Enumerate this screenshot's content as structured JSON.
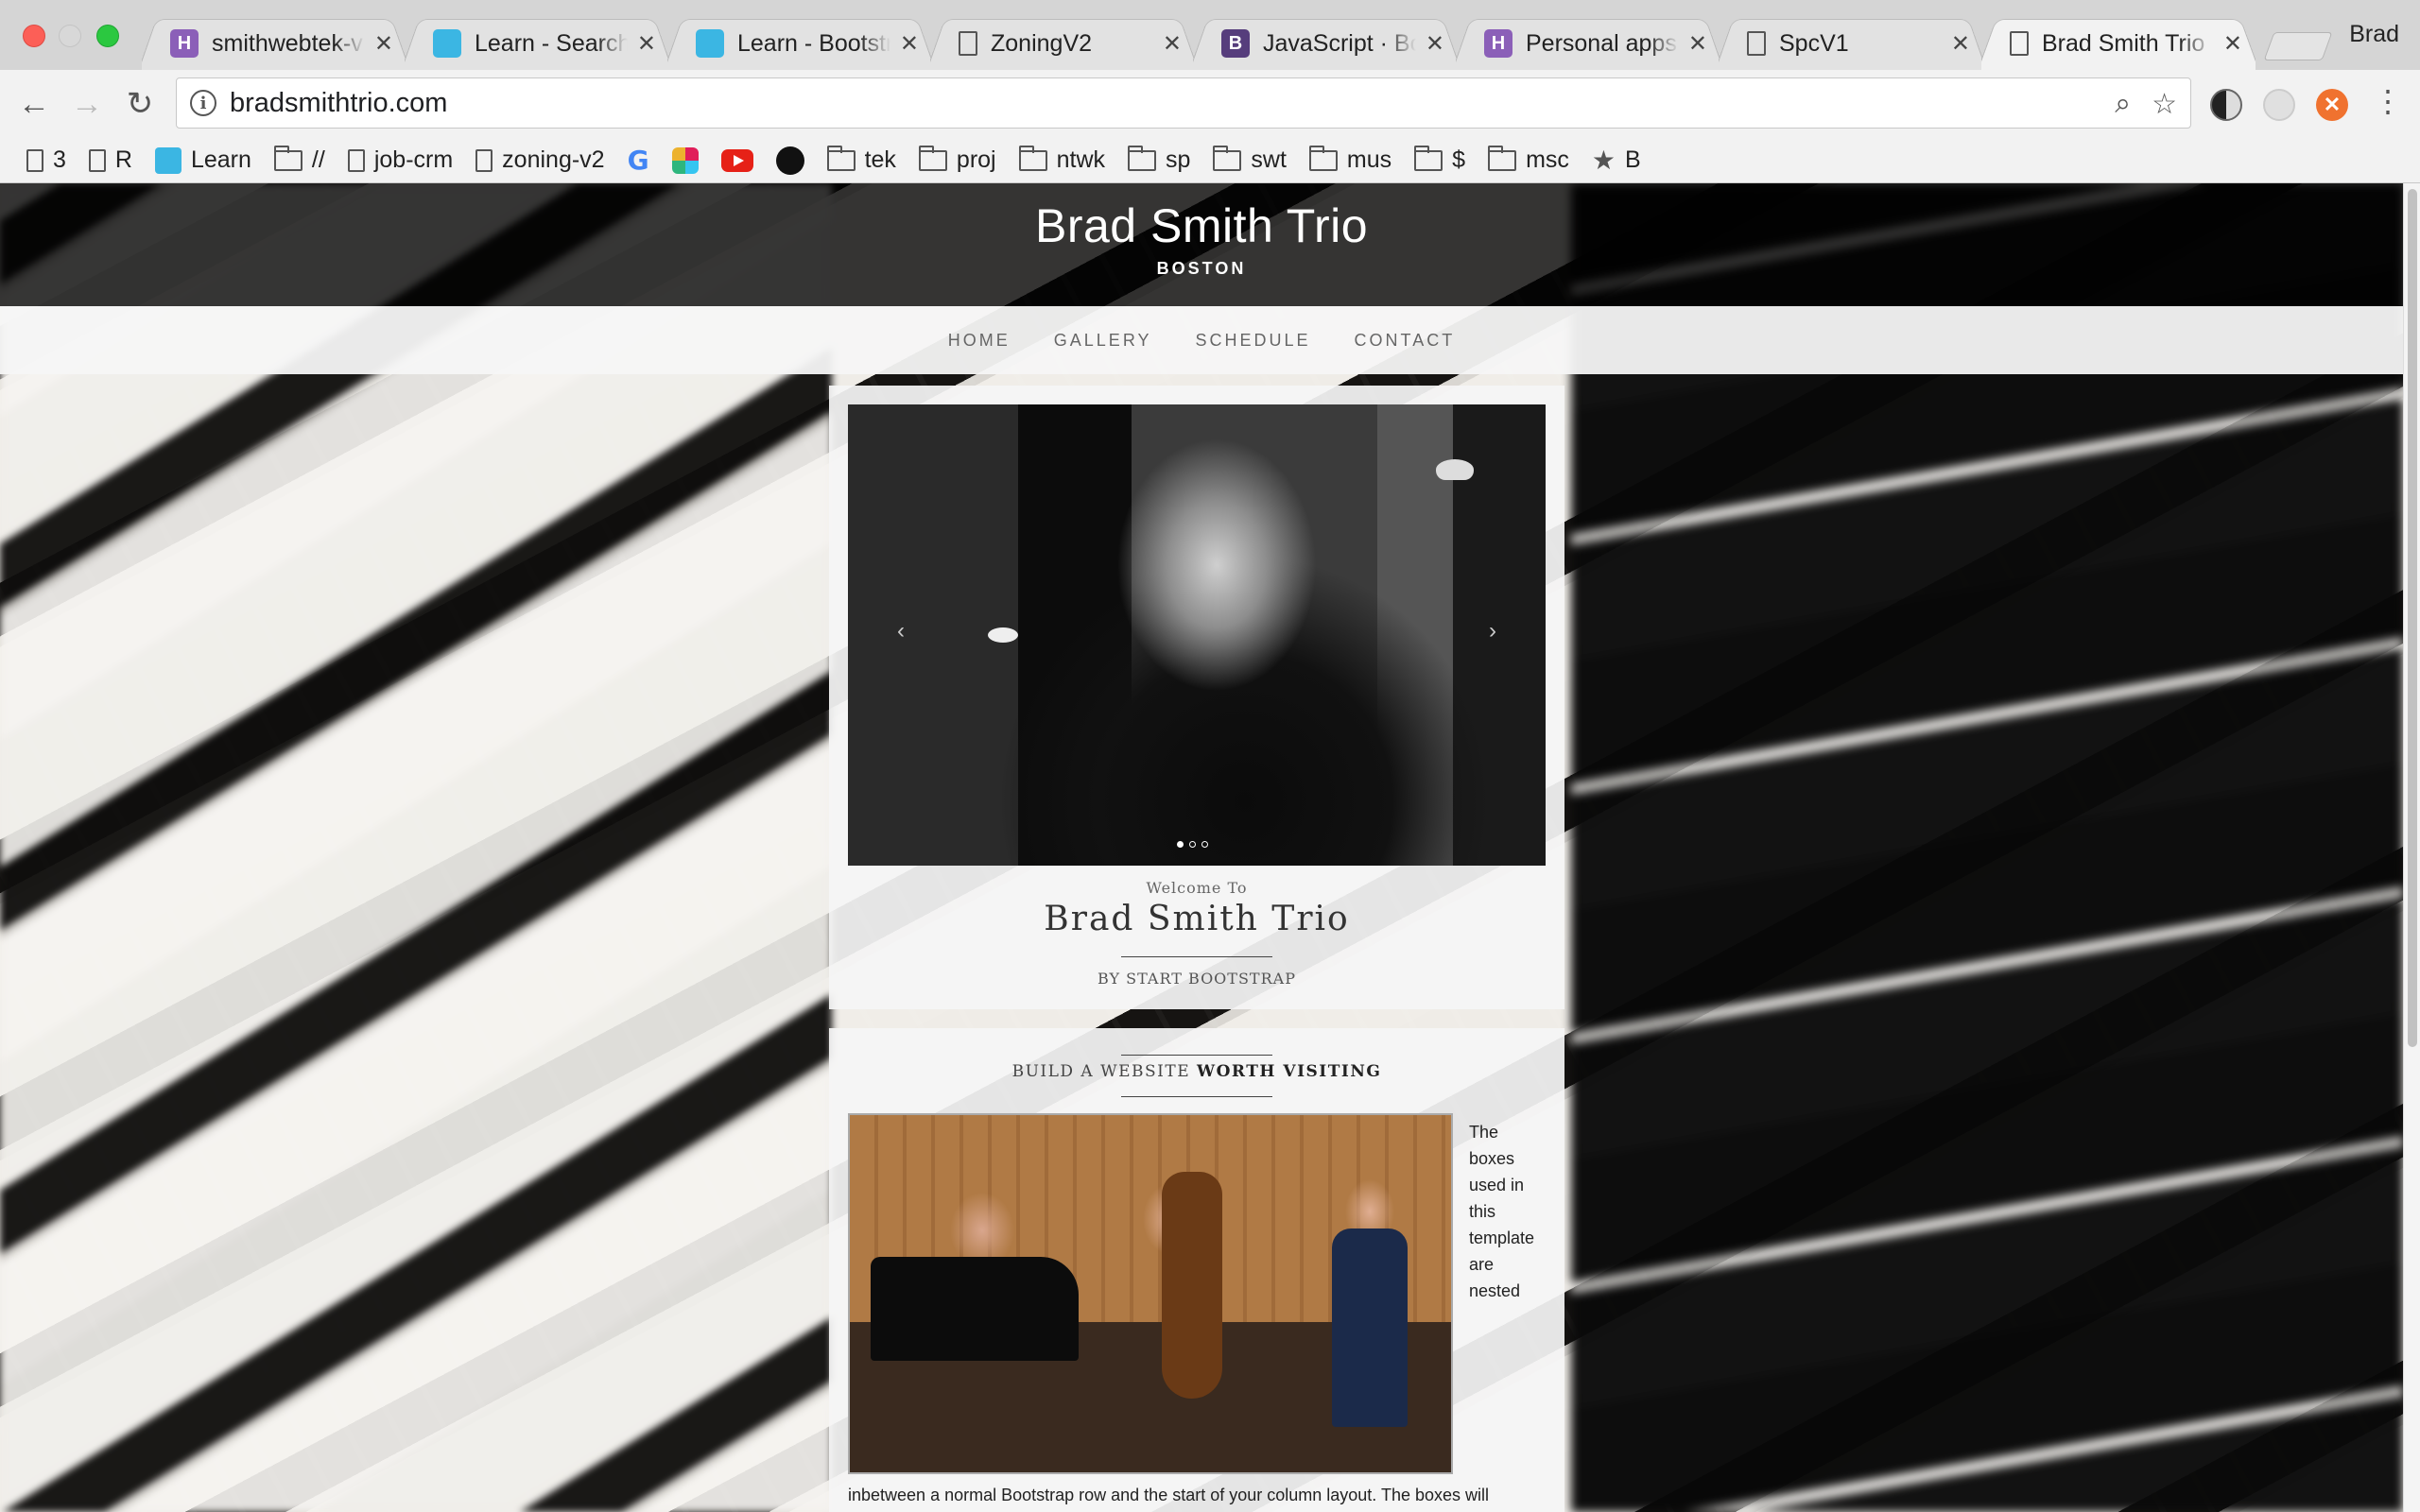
{
  "browser": {
    "tabs": [
      {
        "title": "smithwebtek-v",
        "favicon": "H",
        "favicon_type": "heroku"
      },
      {
        "title": "Learn - Search",
        "favicon": "",
        "favicon_type": "learn"
      },
      {
        "title": "Learn - Bootstr",
        "favicon": "",
        "favicon_type": "learn"
      },
      {
        "title": "ZoningV2",
        "favicon": "",
        "favicon_type": "page"
      },
      {
        "title": "JavaScript · Bo",
        "favicon": "B",
        "favicon_type": "bootstrap"
      },
      {
        "title": "Personal apps",
        "favicon": "H",
        "favicon_type": "heroku"
      },
      {
        "title": "SpcV1",
        "favicon": "",
        "favicon_type": "page"
      },
      {
        "title": "Brad Smith Trio",
        "favicon": "",
        "favicon_type": "page",
        "active": true
      }
    ],
    "profile_name": "Brad",
    "url": "bradsmithtrio.com",
    "bookmarks": [
      {
        "label": "3",
        "icon": "page-icon"
      },
      {
        "label": "R",
        "icon": "page-icon"
      },
      {
        "label": "Learn",
        "icon": "learn-icon"
      },
      {
        "label": "//",
        "icon": "folder-icon"
      },
      {
        "label": "job-crm",
        "icon": "page-icon"
      },
      {
        "label": "zoning-v2",
        "icon": "page-icon"
      },
      {
        "label": "",
        "icon": "google-icon"
      },
      {
        "label": "",
        "icon": "slack-icon"
      },
      {
        "label": "",
        "icon": "youtube-icon"
      },
      {
        "label": "",
        "icon": "github-icon"
      },
      {
        "label": "tek",
        "icon": "folder-icon"
      },
      {
        "label": "proj",
        "icon": "folder-icon"
      },
      {
        "label": "ntwk",
        "icon": "folder-icon"
      },
      {
        "label": "sp",
        "icon": "folder-icon"
      },
      {
        "label": "swt",
        "icon": "folder-icon"
      },
      {
        "label": "mus",
        "icon": "folder-icon"
      },
      {
        "label": "$",
        "icon": "folder-icon"
      },
      {
        "label": "msc",
        "icon": "folder-icon"
      },
      {
        "label": "B",
        "icon": "star-icon"
      }
    ]
  },
  "site": {
    "title": "Brad Smith Trio",
    "location": "BOSTON",
    "nav": [
      "HOME",
      "GALLERY",
      "SCHEDULE",
      "CONTACT"
    ],
    "intro": {
      "welcome": "Welcome To",
      "brand": "Brad Smith Trio",
      "byline_prefix": "BY",
      "byline_name": "START BOOTSTRAP"
    },
    "section": {
      "heading_lead": "BUILD A WEBSITE",
      "heading_bold": "WORTH VISITING",
      "side_text": "The boxes used in this template are nested",
      "paragraph": "inbetween a normal Bootstrap row and the start of your column layout. The boxes will"
    },
    "carousel": {
      "slides": 3,
      "active_index": 0
    }
  }
}
